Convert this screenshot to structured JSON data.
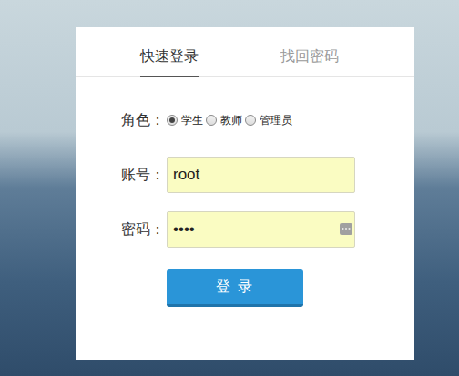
{
  "tabs": [
    {
      "label": "快速登录",
      "selected": true
    },
    {
      "label": "找回密码",
      "selected": false
    }
  ],
  "form": {
    "role": {
      "label": "角色：",
      "options": [
        {
          "label": "学生",
          "selected": true
        },
        {
          "label": "教师",
          "selected": false
        },
        {
          "label": "管理员",
          "selected": false
        }
      ]
    },
    "account": {
      "label": "账号：",
      "value": "root"
    },
    "password": {
      "label": "密码：",
      "value": "••••"
    }
  },
  "button": "登 录"
}
